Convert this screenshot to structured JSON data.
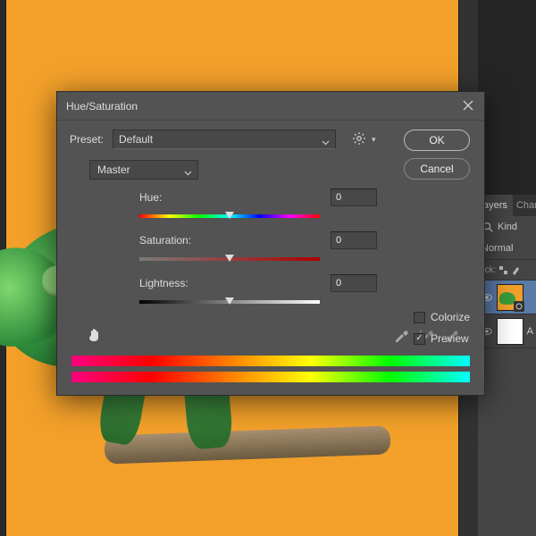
{
  "dialog": {
    "title": "Hue/Saturation",
    "preset_label": "Preset:",
    "preset_value": "Default",
    "ok": "OK",
    "cancel": "Cancel",
    "channel": "Master",
    "hue": {
      "label": "Hue:",
      "value": "0"
    },
    "saturation": {
      "label": "Saturation:",
      "value": "0"
    },
    "lightness": {
      "label": "Lightness:",
      "value": "0"
    },
    "colorize": "Colorize",
    "preview": "Preview"
  },
  "layers": {
    "tab1": "ayers",
    "tab2": "Chan",
    "kind": "Kind",
    "blend": "Normal",
    "locks_label": "ock:",
    "layer_adj_suffix": "A"
  }
}
